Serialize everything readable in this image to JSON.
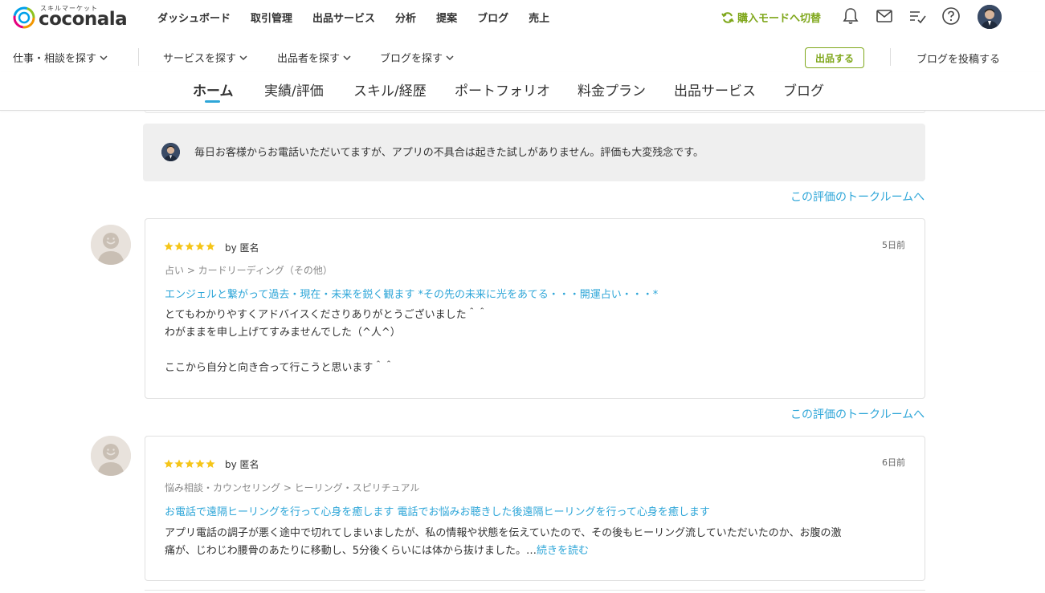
{
  "header": {
    "logo_sub": "スキルマーケット",
    "logo_word": "coconala",
    "nav": [
      "ダッシュボード",
      "取引管理",
      "出品サービス",
      "分析",
      "提案",
      "ブログ",
      "売上"
    ],
    "mode_switch": "購入モードへ切替",
    "icons": [
      "bell-icon",
      "mail-icon",
      "checklist-icon",
      "help-icon"
    ]
  },
  "subnav": {
    "items": [
      "仕事・相談を探す",
      "サービスを探す",
      "出品者を探す",
      "ブログを探す"
    ],
    "sell_button": "出品する",
    "blog_post": "ブログを投稿する"
  },
  "tabs": [
    "ホーム",
    "実績/評価",
    "スキル/経歴",
    "ポートフォリオ",
    "料金プラン",
    "出品サービス",
    "ブログ"
  ],
  "reply": {
    "text": "毎日お客様からお電話いただいてますが、アプリの不具合は起きた試しがありません。評価も大変残念です。"
  },
  "talk_link": "この評価のトークルームへ",
  "reviews": [
    {
      "rating": 5,
      "by": "by 匿名",
      "date": "5日前",
      "category": "占い > カードリーディング（その他）",
      "service": "エンジェルと繋がって過去・現在・未来を鋭く観ます *その先の未来に光をあてる・・・開運占い・・・*",
      "lines": [
        "とてもわかりやすくアドバイスくださりありがとうございました＾＾",
        "わがままを申し上げてすみませんでした（^人^）",
        "",
        "ここから自分と向き合って行こうと思います＾＾"
      ]
    },
    {
      "rating": 5,
      "by": "by 匿名",
      "date": "6日前",
      "category": "悩み相談・カウンセリング > ヒーリング・スピリチュアル",
      "service": "お電話で遠隔ヒーリングを行って心身を癒します 電話でお悩みお聴きした後遠隔ヒーリングを行って心身を癒します",
      "lines": [
        "アプリ電話の調子が悪く途中で切れてしまいましたが、私の情報や状態を伝えていたので、その後もヒーリング流していただいたのか、お腹の激",
        "痛が、じわじわ腰骨のあたりに移動し、5分後くらいには体から抜けました。…"
      ],
      "read_more": "続きを読む"
    }
  ],
  "colors": {
    "accent": "#2ea6d8",
    "brand_green": "#7fa71b",
    "star": "#f5c518"
  }
}
